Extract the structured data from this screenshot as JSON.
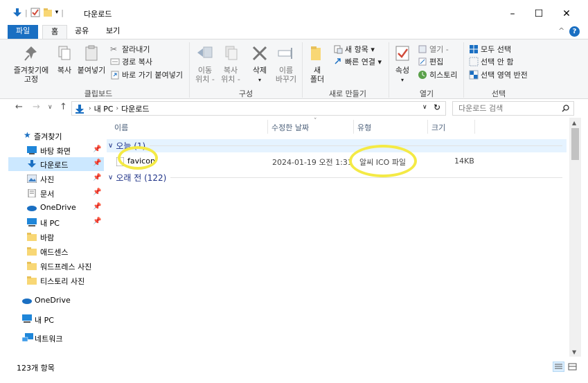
{
  "window": {
    "title": "다운로드",
    "controls": {
      "minimize": "–",
      "maximize": "☐",
      "close": "✕"
    }
  },
  "ribbon_tabs": {
    "file": "파일",
    "home": "홈",
    "share": "공유",
    "view": "보기",
    "collapse": "^",
    "help": "?"
  },
  "ribbon": {
    "clipboard": {
      "label": "클립보드",
      "pin": [
        "즐겨찾기에",
        "고정"
      ],
      "copy": "복사",
      "paste": "붙여넣기",
      "cut": "잘라내기",
      "copy_path": "경로 복사",
      "paste_shortcut": "바로 가기 붙여넣기"
    },
    "organize": {
      "label": "구성",
      "move_to": [
        "이동",
        "위치 -"
      ],
      "copy_to": [
        "복사",
        "위치 -"
      ],
      "delete": "삭제",
      "rename": [
        "이름",
        "바꾸기"
      ]
    },
    "new": {
      "label": "새로 만들기",
      "new_folder": [
        "새",
        "폴더"
      ],
      "new_item": "새 항목 ▾",
      "easy_access": "빠른 연결 ▾"
    },
    "open": {
      "label": "열기",
      "properties": "속성",
      "open": "열기 -",
      "edit": "편집",
      "history": "히스토리"
    },
    "select": {
      "label": "선택",
      "select_all": "모두 선택",
      "select_none": "선택 안 함",
      "invert": "선택 영역 반전"
    }
  },
  "address": {
    "crumbs": [
      "내 PC",
      "다운로드"
    ],
    "search_placeholder": "다운로드 검색"
  },
  "nav": {
    "quick_access": "즐겨찾기",
    "items": [
      {
        "label": "바탕 화면",
        "pinned": true
      },
      {
        "label": "다운로드",
        "pinned": true,
        "selected": true
      },
      {
        "label": "사진",
        "pinned": true
      },
      {
        "label": "문서",
        "pinned": true
      },
      {
        "label": "OneDrive",
        "pinned": true
      },
      {
        "label": "내 PC",
        "pinned": true
      },
      {
        "label": "바람"
      },
      {
        "label": "애드센스"
      },
      {
        "label": "워드프레스 사진"
      },
      {
        "label": "티스토리 사진"
      }
    ],
    "onedrive": "OneDrive",
    "this_pc": "내 PC",
    "network": "네트워크"
  },
  "columns": {
    "name": "이름",
    "date": "수정한 날짜",
    "type": "유형",
    "size": "크기"
  },
  "groups": {
    "today": "오늘 (1)",
    "older": "오래 전 (122)"
  },
  "files": [
    {
      "name": "favicon",
      "date": "2024-01-19 오전 1:31",
      "type": "알씨 ICO 파일",
      "size": "14KB"
    }
  ],
  "status": {
    "count": "123개 항목"
  },
  "colors": {
    "accent": "#1a6fc2",
    "selection": "#cce8ff",
    "highlight_marker": "#f4ea45"
  }
}
